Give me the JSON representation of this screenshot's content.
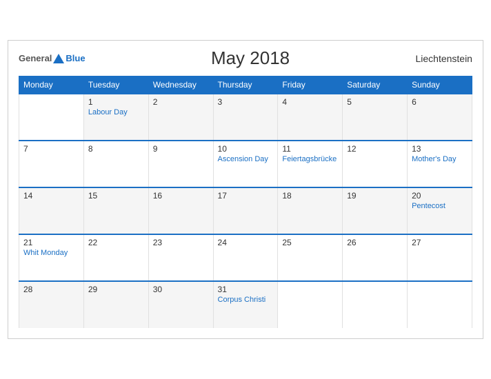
{
  "header": {
    "logo_general": "General",
    "logo_blue": "Blue",
    "title": "May 2018",
    "country": "Liechtenstein"
  },
  "weekdays": [
    "Monday",
    "Tuesday",
    "Wednesday",
    "Thursday",
    "Friday",
    "Saturday",
    "Sunday"
  ],
  "weeks": [
    [
      {
        "day": "",
        "holiday": ""
      },
      {
        "day": "1",
        "holiday": "Labour Day"
      },
      {
        "day": "2",
        "holiday": ""
      },
      {
        "day": "3",
        "holiday": ""
      },
      {
        "day": "4",
        "holiday": ""
      },
      {
        "day": "5",
        "holiday": ""
      },
      {
        "day": "6",
        "holiday": ""
      }
    ],
    [
      {
        "day": "7",
        "holiday": ""
      },
      {
        "day": "8",
        "holiday": ""
      },
      {
        "day": "9",
        "holiday": ""
      },
      {
        "day": "10",
        "holiday": "Ascension Day"
      },
      {
        "day": "11",
        "holiday": "Feiertagsbrücke"
      },
      {
        "day": "12",
        "holiday": ""
      },
      {
        "day": "13",
        "holiday": "Mother's Day"
      }
    ],
    [
      {
        "day": "14",
        "holiday": ""
      },
      {
        "day": "15",
        "holiday": ""
      },
      {
        "day": "16",
        "holiday": ""
      },
      {
        "day": "17",
        "holiday": ""
      },
      {
        "day": "18",
        "holiday": ""
      },
      {
        "day": "19",
        "holiday": ""
      },
      {
        "day": "20",
        "holiday": "Pentecost"
      }
    ],
    [
      {
        "day": "21",
        "holiday": "Whit Monday"
      },
      {
        "day": "22",
        "holiday": ""
      },
      {
        "day": "23",
        "holiday": ""
      },
      {
        "day": "24",
        "holiday": ""
      },
      {
        "day": "25",
        "holiday": ""
      },
      {
        "day": "26",
        "holiday": ""
      },
      {
        "day": "27",
        "holiday": ""
      }
    ],
    [
      {
        "day": "28",
        "holiday": ""
      },
      {
        "day": "29",
        "holiday": ""
      },
      {
        "day": "30",
        "holiday": ""
      },
      {
        "day": "31",
        "holiday": "Corpus Christi"
      },
      {
        "day": "",
        "holiday": ""
      },
      {
        "day": "",
        "holiday": ""
      },
      {
        "day": "",
        "holiday": ""
      }
    ]
  ]
}
